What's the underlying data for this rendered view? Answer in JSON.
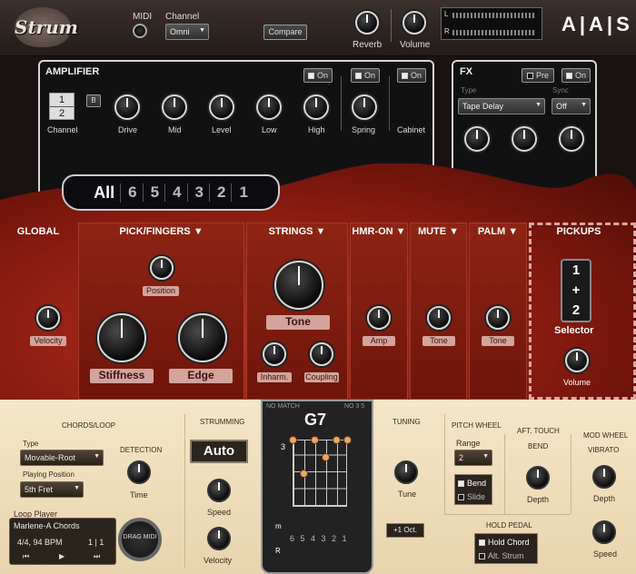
{
  "header": {
    "logo": "Strum",
    "midi_label": "MIDI",
    "channel_label": "Channel",
    "channel_value": "Omni",
    "compare_label": "Compare",
    "reverb_label": "Reverb",
    "volume_label": "Volume",
    "meter_l": "L",
    "meter_r": "R",
    "brand": "A|A|S"
  },
  "amplifier": {
    "title": "AMPLIFIER",
    "channel_a": "1",
    "channel_b": "2",
    "b_button": "B",
    "channel_label": "Channel",
    "knobs": [
      "Drive",
      "Mid",
      "Level",
      "Low",
      "High",
      "Spring"
    ],
    "cabinet_label": "Cabinet",
    "on_label": "On"
  },
  "fx": {
    "title": "FX",
    "pre_label": "Pre",
    "on_label": "On",
    "type_label": "Type",
    "type_value": "Tape Delay",
    "sync_label": "Sync",
    "sync_value": "Off"
  },
  "strings_selector": [
    "All",
    "6",
    "5",
    "4",
    "3",
    "2",
    "1"
  ],
  "sections": {
    "global": "GLOBAL",
    "pick": "PICK/FINGERS ▼",
    "strings": "STRINGS ▼",
    "hmr": "HMR-ON ▼",
    "mute": "MUTE ▼",
    "palm": "PALM ▼",
    "pickups": "PICKUPS"
  },
  "controls": {
    "velocity": "Velocity",
    "position": "Position",
    "stiffness": "Stiffness",
    "edge": "Edge",
    "tone": "Tone",
    "inharm": "Inharm.",
    "coupling": "Coupling",
    "amp": "Amp",
    "mute_tone": "Tone",
    "palm_tone": "Tone",
    "pickup_1": "1",
    "pickup_plus": "+",
    "pickup_2": "2",
    "selector": "Selector",
    "pickup_volume": "Volume"
  },
  "bottom": {
    "chords_loop": "CHORDS/LOOP",
    "type_label": "Type",
    "type_value": "Movable-Root",
    "playing_position_label": "Playing Position",
    "playing_position_value": "5th Fret",
    "detection_label": "DETECTION",
    "time_label": "Time",
    "loop_player": "Loop Player",
    "loop_name": "Marlene-A Chords",
    "loop_meter": "4/4, 94 BPM",
    "loop_pos": "1 | 1",
    "drag_midi": "DRAG MIDI",
    "strumming": "STRUMMING",
    "auto": "Auto",
    "speed_label": "Speed",
    "velocity_label": "Velocity",
    "no_match": "NO MATCH",
    "no_3": "NO 3 5",
    "chord": "G7",
    "fret_num": "3",
    "string_nums": "6 5 4 3 2 1",
    "fret_m": "m",
    "fret_r": "R",
    "tuning": "TUNING",
    "tune_label": "Tune",
    "oct_button": "+1 Oct.",
    "pitch_wheel": "PITCH WHEEL",
    "range_label": "Range",
    "range_value": "2",
    "bend_label": "Bend",
    "slide_label": "Slide",
    "aft_touch": "AFT. TOUCH",
    "bend_title": "BEND",
    "depth_label": "Depth",
    "mod_wheel": "MOD WHEEL",
    "vibrato": "VIBRATO",
    "vib_depth": "Depth",
    "vib_speed": "Speed",
    "hold_pedal": "HOLD PEDAL",
    "hold_chord": "Hold Chord",
    "alt_strum": "Alt. Strum"
  }
}
